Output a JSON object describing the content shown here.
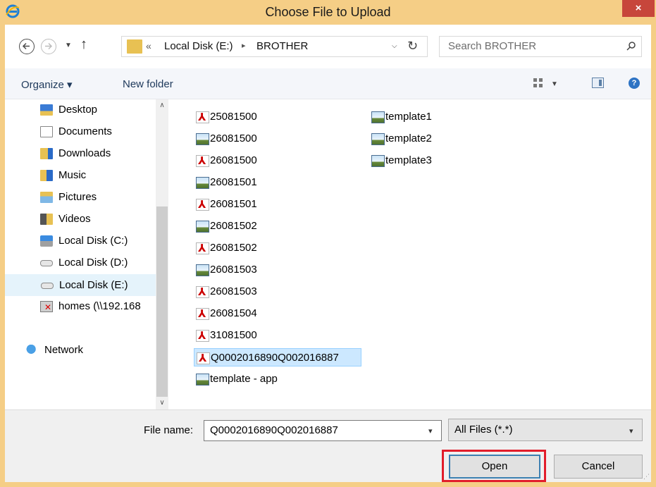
{
  "window": {
    "title": "Choose File to Upload",
    "close_label": "×"
  },
  "address": {
    "overflow": "«",
    "crumbs": [
      "Local Disk (E:)",
      "BROTHER"
    ],
    "separator": "▸",
    "search_placeholder": "Search BROTHER"
  },
  "toolbar": {
    "organize_label": "Organize ▾",
    "new_folder_label": "New folder",
    "help_label": "?"
  },
  "nav": {
    "items": [
      {
        "label": "Desktop",
        "icon": "desktop-folder-icon"
      },
      {
        "label": "Documents",
        "icon": "documents-folder-icon"
      },
      {
        "label": "Downloads",
        "icon": "downloads-folder-icon"
      },
      {
        "label": "Music",
        "icon": "music-folder-icon"
      },
      {
        "label": "Pictures",
        "icon": "pictures-folder-icon"
      },
      {
        "label": "Videos",
        "icon": "videos-folder-icon"
      },
      {
        "label": "Local Disk (C:)",
        "icon": "system-drive-icon"
      },
      {
        "label": "Local Disk (D:)",
        "icon": "drive-icon"
      },
      {
        "label": "Local Disk (E:)",
        "icon": "drive-icon",
        "selected": true
      },
      {
        "label": "homes (\\\\192.168",
        "icon": "disconnected-network-drive-icon"
      },
      {
        "label": "Network",
        "icon": "network-icon"
      }
    ]
  },
  "files": {
    "column1": [
      {
        "name": "25081500",
        "type": "pdf"
      },
      {
        "name": "26081500",
        "type": "image"
      },
      {
        "name": "26081500",
        "type": "pdf"
      },
      {
        "name": "26081501",
        "type": "image"
      },
      {
        "name": "26081501",
        "type": "pdf"
      },
      {
        "name": "26081502",
        "type": "image"
      },
      {
        "name": "26081502",
        "type": "pdf"
      },
      {
        "name": "26081503",
        "type": "image"
      },
      {
        "name": "26081503",
        "type": "pdf"
      },
      {
        "name": "26081504",
        "type": "pdf"
      },
      {
        "name": "31081500",
        "type": "pdf"
      },
      {
        "name": "Q0002016890Q002016887",
        "type": "pdf",
        "selected": true
      },
      {
        "name": "template - app",
        "type": "image"
      }
    ],
    "column2": [
      {
        "name": "template1",
        "type": "image"
      },
      {
        "name": "template2",
        "type": "image"
      },
      {
        "name": "template3",
        "type": "image"
      }
    ]
  },
  "bottom": {
    "file_name_label": "File name:",
    "file_name_value": "Q0002016890Q002016887",
    "filter_value": "All Files (*.*)",
    "open_label": "Open",
    "cancel_label": "Cancel"
  },
  "colors": {
    "titlebar": "#f5ce86",
    "close_button": "#c7463b",
    "highlight_box": "#e21d2b",
    "selection": "#cce8ff"
  }
}
